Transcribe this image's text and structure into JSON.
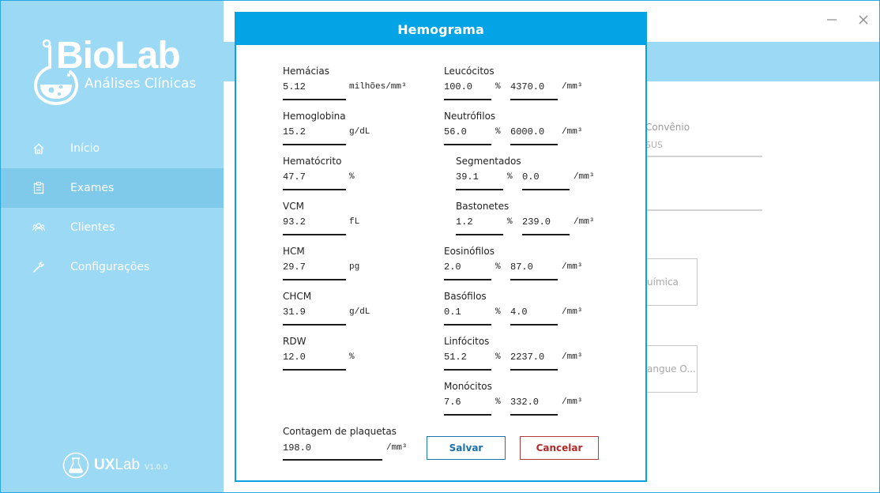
{
  "brand": {
    "name": "BioLab",
    "tagline": "Análises Clínicas",
    "footer_ux": "UX",
    "footer_lab": "Lab",
    "footer_version": "V1.0.0"
  },
  "sidebar": {
    "items": [
      {
        "label": "Início",
        "icon": "home-icon"
      },
      {
        "label": "Exames",
        "icon": "clipboard-icon"
      },
      {
        "label": "Clientes",
        "icon": "users-icon"
      },
      {
        "label": "Configurações",
        "icon": "wrench-icon"
      }
    ]
  },
  "background": {
    "convenio_label": "Convênio",
    "convenio_value": "SUS",
    "card1_text": "uímica",
    "card2_text": "angue O..."
  },
  "dialog": {
    "title": "Hemograma",
    "left": [
      {
        "label": "Hemácias",
        "value": "5.12",
        "unit": "milhões/mm³"
      },
      {
        "label": "Hemoglobina",
        "value": "15.2",
        "unit": "g/dL"
      },
      {
        "label": "Hematócrito",
        "value": "47.7",
        "unit": "%"
      },
      {
        "label": "VCM",
        "value": "93.2",
        "unit": "fL"
      },
      {
        "label": "HCM",
        "value": "29.7",
        "unit": "pg"
      },
      {
        "label": "CHCM",
        "value": "31.9",
        "unit": "g/dL"
      },
      {
        "label": "RDW",
        "value": "12.0",
        "unit": "%"
      }
    ],
    "right": [
      {
        "label": "Leucócitos",
        "pct": "100.0",
        "abs": "4370.0"
      },
      {
        "label": "Neutrófilos",
        "pct": "56.0",
        "abs": "6000.0"
      },
      {
        "label": "Segmentados",
        "pct": "39.1",
        "abs": "0.0"
      },
      {
        "label": "Bastonetes",
        "pct": "1.2",
        "abs": "239.0"
      },
      {
        "label": "Eosinófilos",
        "pct": "2.0",
        "abs": "87.0"
      },
      {
        "label": "Basófilos",
        "pct": "0.1",
        "abs": "4.0"
      },
      {
        "label": "Linfócitos",
        "pct": "51.2",
        "abs": "2237.0"
      },
      {
        "label": "Monócitos",
        "pct": "7.6",
        "abs": "332.0"
      }
    ],
    "pct_symbol": "%",
    "abs_unit": "/mm³",
    "platelets": {
      "label": "Contagem de plaquetas",
      "value": "198.0",
      "unit": "/mm³"
    },
    "save_label": "Salvar",
    "cancel_label": "Cancelar"
  }
}
